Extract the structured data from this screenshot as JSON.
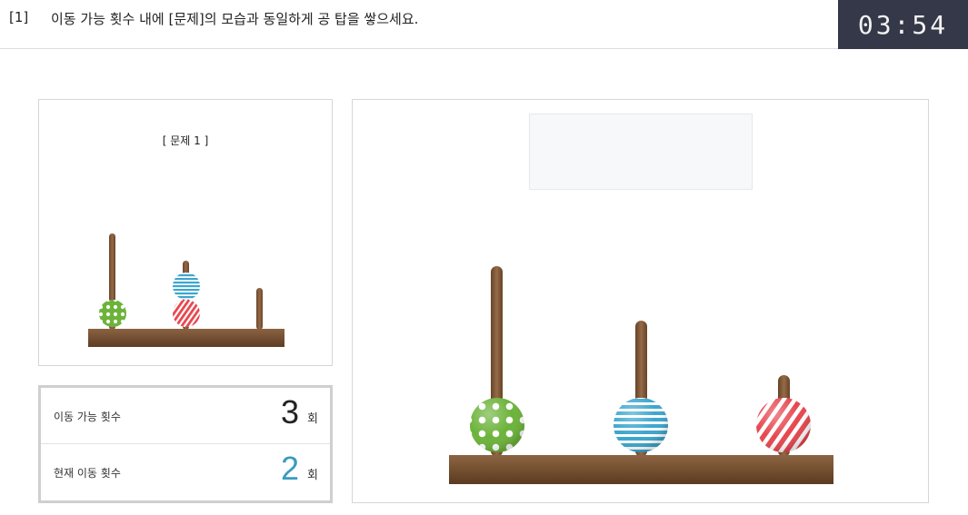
{
  "header": {
    "question_number": "[1]",
    "instruction": "이동 가능 횟수 내에 [문제]의 모습과 동일하게 공 탑을 쌓으세요.",
    "timer": "03:54"
  },
  "problem": {
    "title": "[ 문제 1 ]",
    "pegs": [
      {
        "balls": [
          "green-dots"
        ]
      },
      {
        "balls": [
          "red-stripes",
          "blue-stripes"
        ]
      },
      {
        "balls": []
      }
    ]
  },
  "counters": {
    "allowed_label": "이동 가능 횟수",
    "allowed_value": "3",
    "allowed_unit": "회",
    "current_label": "현재 이동 횟수",
    "current_value": "2",
    "current_unit": "회"
  },
  "board": {
    "pegs": [
      {
        "balls": [
          "green-dots"
        ]
      },
      {
        "balls": [
          "blue-stripes"
        ]
      },
      {
        "balls": [
          "red-stripes"
        ]
      }
    ]
  },
  "colors": {
    "timer_bg": "#353848",
    "allowed_value": "#222222",
    "current_value": "#3a9bc0",
    "wood": "#7a5434",
    "green": "#6cb33a",
    "blue": "#3ba6cf",
    "red": "#e7474f"
  }
}
